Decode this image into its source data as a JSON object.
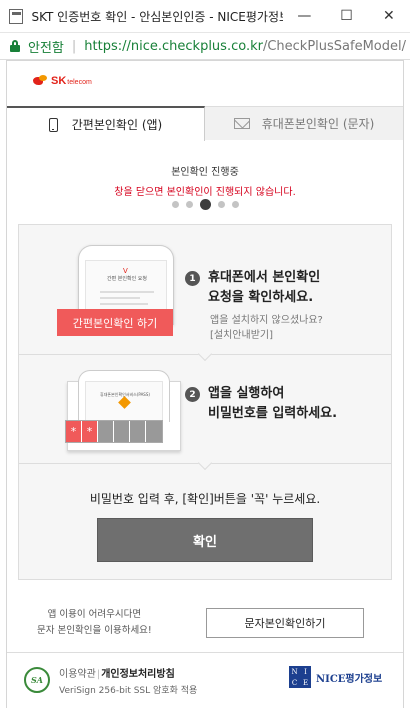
{
  "window": {
    "title": "SKT 인증번호 확인 - 안심본인인증 - NICE평가정보",
    "minimize_glyph": "—",
    "maximize_glyph": "☐",
    "close_glyph": "✕"
  },
  "address": {
    "secure_label": "안전함",
    "separator": "|",
    "scheme_host": "https://nice.checkplus.co.kr",
    "path": "/CheckPlusSafeModel/"
  },
  "logo": {
    "brand": "SK",
    "suffix": "telecom"
  },
  "tabs": [
    {
      "label": "간편본인확인 (앱)",
      "active": true,
      "icon": "phone-icon"
    },
    {
      "label": "휴대폰본인확인 (문자)",
      "active": false,
      "icon": "mail-icon"
    }
  ],
  "progress": {
    "status": "본인확인 진행중",
    "warning": "창을 닫으면 본인확인이 진행되지 않습니다.",
    "current_step": 3,
    "total_steps": 5
  },
  "step1": {
    "number": "1",
    "title_line1": "휴대폰에서 본인확인",
    "title_line2": "요청을 확인하세요.",
    "sub_line1": "앱을 설치하지 않으셨나요?",
    "sub_line2": "[설치안내받기]",
    "button": "간편본인확인 하기",
    "phone_screen_text": "간편 본인확인 요청"
  },
  "step2": {
    "number": "2",
    "title_line1": "앱을 실행하여",
    "title_line2": "비밀번호를 입력하세요.",
    "phone_screen_text": "휴대폰본인확인서비스(PASS)",
    "pin_filled": [
      "*",
      "*"
    ],
    "pin_total": 6
  },
  "confirm": {
    "instruction": "비밀번호 입력 후, [확인]버튼을 '꼭' 누르세요.",
    "button": "확인"
  },
  "sms": {
    "line1": "앱 이용이 어려우시다면",
    "line2": "문자 본인확인을 이용하세요!",
    "button": "문자본인확인하기"
  },
  "footer": {
    "seal": "SA",
    "terms": "이용약관",
    "sep": "|",
    "privacy": "개인정보처리방침",
    "ssl": "VeriSign 256-bit SSL 암호화 적용",
    "nice_letters": [
      "N",
      "I",
      "C",
      "E"
    ],
    "nice_name": "NICE평가정보"
  },
  "colors": {
    "accent_red": "#f05a5a",
    "warning_red": "#d6001c",
    "secure_green": "#188038",
    "nice_blue": "#1c3f8f"
  }
}
